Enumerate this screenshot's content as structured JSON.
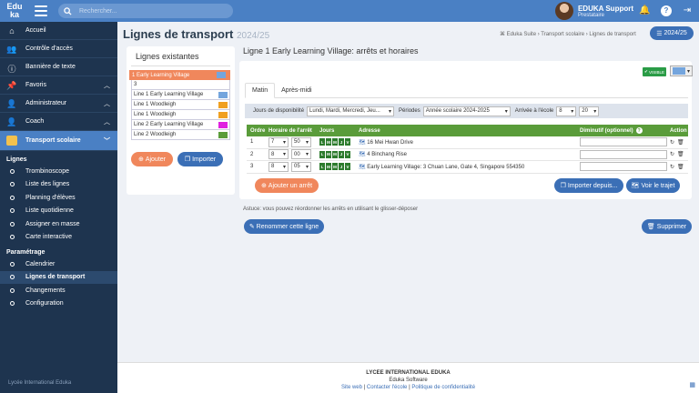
{
  "topbar": {
    "logo_top": "Edu",
    "logo_bottom": "ka",
    "search_placeholder": "Rechercher...",
    "user_name": "EDUKA Support",
    "user_role": "Prestataire"
  },
  "sidebar": {
    "items": [
      {
        "label": "Accueil",
        "icon": "home-icon"
      },
      {
        "label": "Contrôle d'accès",
        "icon": "users-icon"
      },
      {
        "label": "Bannière de texte",
        "icon": "info-icon"
      },
      {
        "label": "Favoris",
        "icon": "pin-icon"
      },
      {
        "label": "Administrateur",
        "icon": "user-gear-icon"
      },
      {
        "label": "Coach",
        "icon": "user-gear-icon"
      },
      {
        "label": "Transport scolaire",
        "icon": "bus-icon"
      }
    ],
    "section_lignes": "Lignes",
    "lignes": [
      "Trombinoscope",
      "Liste des lignes",
      "Planning d'élèves",
      "Liste quotidienne",
      "Assigner en masse",
      "Carte interactive"
    ],
    "section_param": "Paramétrage",
    "param": [
      "Calendrier",
      "Lignes de transport",
      "Changements",
      "Configuration"
    ],
    "footer": "Lycée International Eduka"
  },
  "page": {
    "title": "Lignes de transport",
    "year": "2024/25",
    "breadcrumb": "Eduka Suite › Transport scolaire › Lignes de transport",
    "year_button": "2024/25"
  },
  "existing": {
    "heading": "Lignes existantes",
    "lines": [
      {
        "label": "1 Early Learning Village",
        "color": "#74a5dd",
        "selected": true
      },
      {
        "label": "3",
        "color": "",
        "selected": false
      },
      {
        "label": "Line 1 Early Learning Village",
        "color": "#74a5dd",
        "selected": false
      },
      {
        "label": "Line 1 Woodleigh",
        "color": "#f0a020",
        "selected": false
      },
      {
        "label": "Line 1 Woodleigh",
        "color": "#f0a020",
        "selected": false
      },
      {
        "label": "Line 2 Early Learning Village",
        "color": "#e020e0",
        "selected": false
      },
      {
        "label": "Line 2 Woodleigh",
        "color": "#5a9c3a",
        "selected": false
      }
    ],
    "add": "Ajouter",
    "import": "Importer"
  },
  "detail": {
    "title": "Ligne 1 Early Learning Village: arrêts et horaires",
    "visible": "VISIBLE",
    "tabs": [
      "Matin",
      "Après-midi"
    ],
    "filter": {
      "days_label": "Jours de disponibilité",
      "days_value": "Lundi, Mardi, Mercredi, Jeu...",
      "period_label": "Périodes",
      "period_value": "Année scolaire 2024-2025",
      "arrival_label": "Arrivée à l'école",
      "arrival_h": "8",
      "arrival_m": "20"
    },
    "table": {
      "headers": [
        "Ordre",
        "Horaire de l'arrêt",
        "Jours",
        "Adresse",
        "Diminutif (optionnel)",
        "Action"
      ],
      "rows": [
        {
          "order": "1",
          "h": "7",
          "m": "50",
          "address": "16 Mei Hwan Drive"
        },
        {
          "order": "2",
          "h": "8",
          "m": "00",
          "address": "4 Binchang Rise"
        },
        {
          "order": "3",
          "h": "8",
          "m": "05",
          "address": "Early Learning Village: 3 Chuan Lane, Gate 4, Singapore 554350"
        }
      ],
      "days": [
        "L",
        "M",
        "M",
        "J",
        "V"
      ]
    },
    "add_stop": "Ajouter un arrêt",
    "import_from": "Importer depuis...",
    "see_route": "Voir le trajet"
  },
  "astuce": "Astuce: vous pouvez réordonner les arrêts en utilisant le glisser-déposer",
  "rename": "Renommer cette ligne",
  "delete": "Supprimer",
  "footer": {
    "school": "LYCEE INTERNATIONAL EDUKA",
    "vendor": "Eduka Software",
    "links": [
      "Site web",
      "Contacter l'école",
      "Politique de confidentialité"
    ]
  },
  "colors": {
    "primary": "#4a80c4",
    "sidebar": "#1e344f",
    "orange": "#f0875c",
    "green": "#5a9c3a"
  }
}
